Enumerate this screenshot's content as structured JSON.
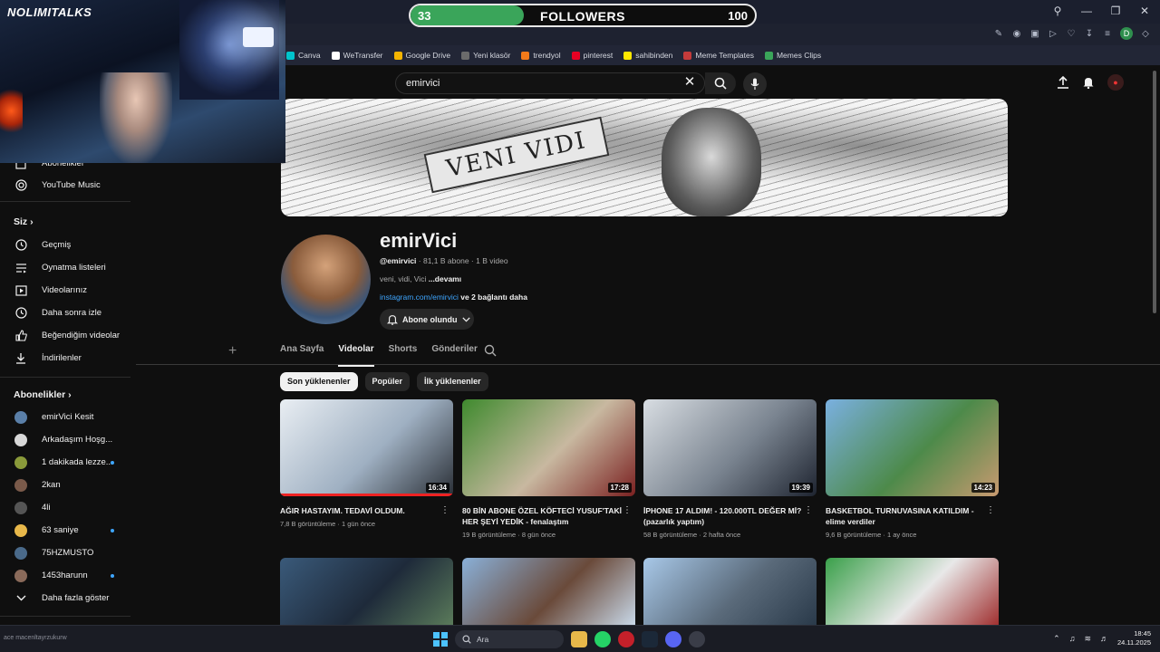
{
  "overlay": {
    "brand": "NOLIMITALKS",
    "followers": {
      "current": "33",
      "label": "FOLLOWERS",
      "goal": "100",
      "progress": 0.33
    }
  },
  "bookmarks": [
    {
      "label": "Canva",
      "color": "#00c4cc"
    },
    {
      "label": "WeTransfer",
      "color": "#ffffff"
    },
    {
      "label": "Google Drive",
      "color": "#f4b400"
    },
    {
      "label": "Yeni klasör",
      "color": "#6b6b6b"
    },
    {
      "label": "trendyol",
      "color": "#f27a1a"
    },
    {
      "label": "pinterest",
      "color": "#e60023"
    },
    {
      "label": "sahibinden",
      "color": "#ffe800"
    },
    {
      "label": "Meme Templates",
      "color": "#c43b3b"
    },
    {
      "label": "Memes Clips",
      "color": "#3aa55a"
    }
  ],
  "search": {
    "value": "emirvici"
  },
  "sidebar": {
    "top_items": [
      {
        "label": "Abonelikler",
        "icon": "subscriptions-icon"
      },
      {
        "label": "YouTube Music",
        "icon": "youtube-music-icon"
      }
    ],
    "you_header": "Siz",
    "you_items": [
      {
        "label": "Geçmiş",
        "icon": "history-icon"
      },
      {
        "label": "Oynatma listeleri",
        "icon": "playlists-icon"
      },
      {
        "label": "Videolarınız",
        "icon": "your-videos-icon"
      },
      {
        "label": "Daha sonra izle",
        "icon": "watch-later-icon"
      },
      {
        "label": "Beğendiğim videolar",
        "icon": "liked-icon"
      },
      {
        "label": "İndirilenler",
        "icon": "downloads-icon"
      }
    ],
    "subs_header": "Abonelikler",
    "subs": [
      {
        "label": "emirVici Kesit",
        "color": "#5a7fa8",
        "dot": false
      },
      {
        "label": "Arkadaşım Hoşg...",
        "color": "#d8d8d8",
        "dot": false
      },
      {
        "label": "1 dakikada lezze...",
        "color": "#8a9a3a",
        "dot": true
      },
      {
        "label": "2kan",
        "color": "#7a5a4a",
        "dot": false
      },
      {
        "label": "4li",
        "color": "#555555",
        "dot": false
      },
      {
        "label": "63 saniye",
        "color": "#e8b84a",
        "dot": true
      },
      {
        "label": "75HZMUSTO",
        "color": "#4a6a8a",
        "dot": false
      },
      {
        "label": "1453harunn",
        "color": "#8a6a5a",
        "dot": true
      }
    ],
    "show_more": "Daha fazla göster"
  },
  "channel": {
    "banner_text": "VENI VIDI",
    "name": "emirVici",
    "handle": "@emirvici",
    "stats": " · 81,1 B abone · 1 B video",
    "desc": "veni, vidi, Vici",
    "more": "...devamı",
    "link": "instagram.com/emirvici",
    "link_suffix": " ve 2 bağlantı daha",
    "sub_label": "Abone olundu"
  },
  "tabs": [
    {
      "label": "Ana Sayfa",
      "active": false
    },
    {
      "label": "Videolar",
      "active": true
    },
    {
      "label": "Shorts",
      "active": false
    },
    {
      "label": "Gönderiler",
      "active": false
    }
  ],
  "chips": [
    {
      "label": "Son yüklenenler",
      "active": true
    },
    {
      "label": "Popüler",
      "active": false
    },
    {
      "label": "İlk yüklenenler",
      "active": false
    }
  ],
  "videos": [
    {
      "title": "AĞIR HASTAYIM. TEDAVİ OLDUM.",
      "meta": "7,8 B görüntüleme · 1 gün önce",
      "duration": "16:34",
      "watched": 1.0,
      "colors": [
        "#e9eef3",
        "#9fb0c2",
        "#2a2f36"
      ]
    },
    {
      "title": "80 BİN ABONE ÖZEL KÖFTECİ YUSUF'TAKİ HER ŞEYİ YEDİK - fenalaştım",
      "meta": "19 B görüntüleme · 8 gün önce",
      "duration": "17:28",
      "watched": 0,
      "colors": [
        "#3f8a2e",
        "#c8b8a0",
        "#7a2020"
      ]
    },
    {
      "title": "İPHONE 17 ALDIM! - 120.000TL DEĞER Mİ? (pazarlık yaptım)",
      "meta": "58 B görüntüleme · 2 hafta önce",
      "duration": "19:39",
      "watched": 0,
      "colors": [
        "#d8dde2",
        "#7a8490",
        "#1e2430"
      ]
    },
    {
      "title": "BASKETBOL TURNUVASINA KATILDIM - elime verdiler",
      "meta": "9,6 B görüntüleme · 1 ay önce",
      "duration": "14:23",
      "watched": 0,
      "colors": [
        "#7ab0e0",
        "#4d8a4a",
        "#c89a70"
      ]
    }
  ],
  "videos_row2": [
    {
      "colors": [
        "#3a5a7a",
        "#1e2a3a",
        "#5a7a5a"
      ]
    },
    {
      "colors": [
        "#8ab0d8",
        "#6a4a3a",
        "#c8d8e8"
      ]
    },
    {
      "colors": [
        "#a8c8e8",
        "#5a6a7a",
        "#2a3a4a"
      ]
    },
    {
      "colors": [
        "#3aa04a",
        "#e8e8e8",
        "#a03030"
      ]
    }
  ],
  "taskbar": {
    "left_text": "ace macenltayrzukurw",
    "search_placeholder": "Ara",
    "time": "18:45",
    "date": "24.11.2025"
  }
}
